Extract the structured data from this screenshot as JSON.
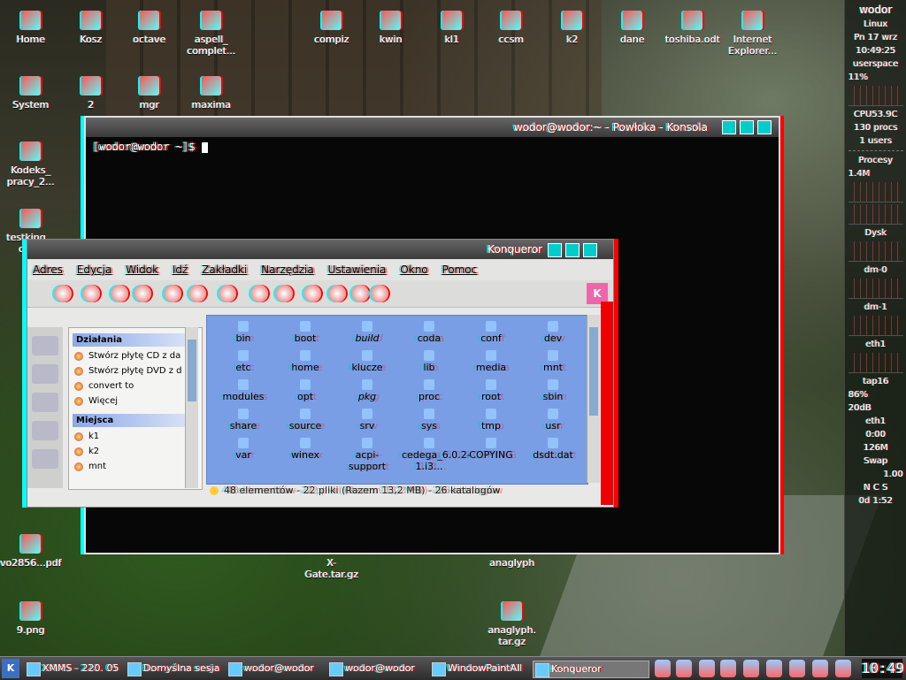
{
  "desktop_icons": [
    {
      "label": "Home"
    },
    {
      "label": "Kosz"
    },
    {
      "label": "octave"
    },
    {
      "label": "aspell_ complet..."
    },
    {
      "label": "compiz"
    },
    {
      "label": "kwin"
    },
    {
      "label": "kl1"
    },
    {
      "label": "ccsm"
    },
    {
      "label": "k2"
    },
    {
      "label": "dane"
    },
    {
      "label": "toshiba.odt"
    },
    {
      "label": "Internet Explorer..."
    },
    {
      "label": "System"
    },
    {
      "label": "2"
    },
    {
      "label": "mgr"
    },
    {
      "label": "maxima"
    },
    {
      "label": "Kodeks_ pracy_2..."
    },
    {
      "label": "testking... cisco"
    },
    {
      "label": "vo2856...pdf"
    },
    {
      "label": "9.png"
    },
    {
      "label": "X-Gate.tar.gz"
    },
    {
      "label": "anaglyph"
    },
    {
      "label": "anaglyph. tar.gz"
    }
  ],
  "monitor": {
    "host": "wodor",
    "os": "Linux",
    "date": "Pn 17 wrz",
    "time": "10:49:25",
    "governor": "userspace",
    "cpu_percent": "11%",
    "cpu_info": "CPU53.9C",
    "procs": "130 procs",
    "users": "1 users",
    "procesy_label": "Procesy",
    "mem": "1.4M",
    "dysk_label": "Dysk",
    "dm0": "dm-0",
    "dm1": "dm-1",
    "eth1_label": "eth1",
    "tap_label": "tap16",
    "tap_pct": "86%",
    "db": "20dB",
    "eth1b": "eth1",
    "net_time": "0:00",
    "net_size": "126M",
    "swap_label": "Swap",
    "swap_val": "1.00",
    "ncs": "N C S",
    "uptime": "0d 1:52"
  },
  "konsole": {
    "title": "wodor@wodor:~ - Powłoka - Konsola",
    "prompt": "[wodor@wodor ~]$"
  },
  "konqueror": {
    "title": "Konqueror",
    "menu": [
      "Adres",
      "Edycja",
      "Widok",
      "Idź",
      "Zakładki",
      "Narzędzia",
      "Ustawienia",
      "Okno",
      "Pomoc"
    ],
    "sidebar": {
      "group1": "Działania",
      "actions": [
        "Stwórz płytę CD z da",
        "Stwórz płytę DVD z d",
        "convert to",
        "Więcej"
      ],
      "group2": "Miejsca",
      "places": [
        "k1",
        "k2",
        "mnt"
      ]
    },
    "files": [
      {
        "name": "bin"
      },
      {
        "name": "boot"
      },
      {
        "name": "build",
        "italic": true
      },
      {
        "name": "coda"
      },
      {
        "name": "conf"
      },
      {
        "name": "dev"
      },
      {
        "name": "etc"
      },
      {
        "name": "home"
      },
      {
        "name": "klucze"
      },
      {
        "name": "lib"
      },
      {
        "name": "media"
      },
      {
        "name": "mnt"
      },
      {
        "name": "modules"
      },
      {
        "name": "opt"
      },
      {
        "name": "pkg",
        "italic": true
      },
      {
        "name": "proc"
      },
      {
        "name": "root"
      },
      {
        "name": "sbin"
      },
      {
        "name": "share"
      },
      {
        "name": "source"
      },
      {
        "name": "srv"
      },
      {
        "name": "sys"
      },
      {
        "name": "tmp"
      },
      {
        "name": "usr"
      },
      {
        "name": "var"
      },
      {
        "name": "winex"
      },
      {
        "name": "acpi-support"
      },
      {
        "name": "cedega_6.0.2-1.i3..."
      },
      {
        "name": "COPYING"
      },
      {
        "name": "dsdt.dat"
      }
    ],
    "status": "48 elementów - 22 pliki (Razem 13,2 MB) - 26 katalogów"
  },
  "taskbar": {
    "kmenu": "K",
    "tasks": [
      "XMMS - 220. 05",
      "Domyślna sesja",
      "wodor@wodor",
      "wodor@wodor",
      "WindowPaintAll",
      "Konqueror"
    ],
    "clock": "10:49"
  }
}
